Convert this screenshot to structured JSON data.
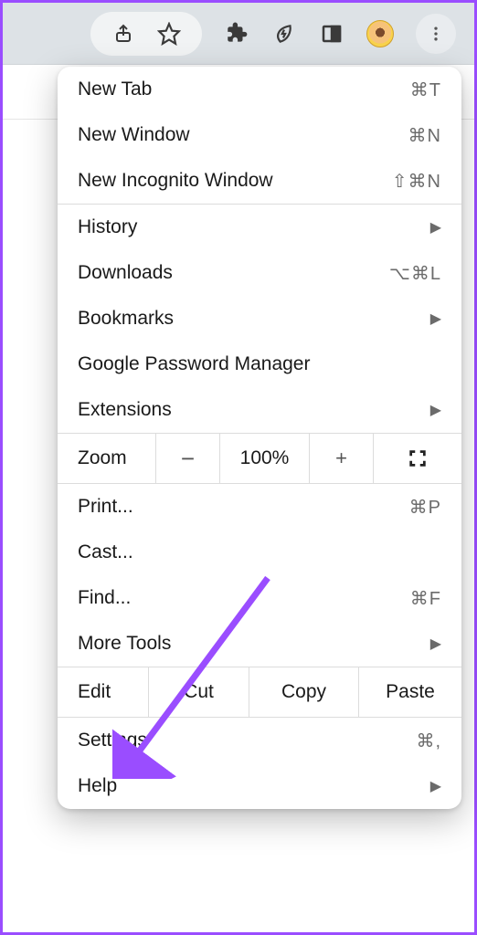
{
  "menu": {
    "new_tab": {
      "label": "New Tab",
      "shortcut": "⌘T"
    },
    "new_window": {
      "label": "New Window",
      "shortcut": "⌘N"
    },
    "new_incognito": {
      "label": "New Incognito Window",
      "shortcut": "⇧⌘N"
    },
    "history": {
      "label": "History"
    },
    "downloads": {
      "label": "Downloads",
      "shortcut": "⌥⌘L"
    },
    "bookmarks": {
      "label": "Bookmarks"
    },
    "password_manager": {
      "label": "Google Password Manager"
    },
    "extensions": {
      "label": "Extensions"
    },
    "zoom": {
      "label": "Zoom",
      "minus": "−",
      "value": "100%",
      "plus": "+"
    },
    "print": {
      "label": "Print...",
      "shortcut": "⌘P"
    },
    "cast": {
      "label": "Cast..."
    },
    "find": {
      "label": "Find...",
      "shortcut": "⌘F"
    },
    "more_tools": {
      "label": "More Tools"
    },
    "edit": {
      "label": "Edit",
      "cut": "Cut",
      "copy": "Copy",
      "paste": "Paste"
    },
    "settings": {
      "label": "Settings",
      "shortcut": "⌘,"
    },
    "help": {
      "label": "Help"
    }
  }
}
